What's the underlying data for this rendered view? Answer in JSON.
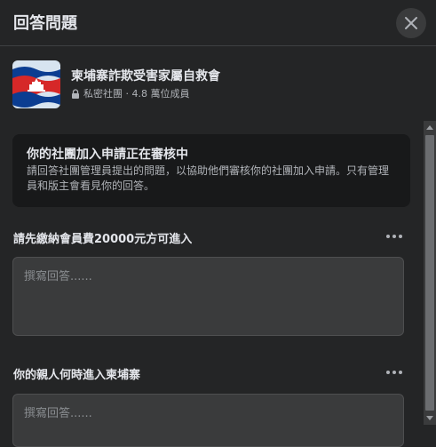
{
  "header": {
    "title": "回答問題",
    "close_icon": "close-icon"
  },
  "group": {
    "name": "柬埔寨詐欺受害家屬自救會",
    "privacy": "私密社團",
    "separator": " · ",
    "members": "4.8 萬位成員",
    "avatar_icon": "cambodia-flag-icon",
    "lock_icon": "lock-icon"
  },
  "notice": {
    "title": "你的社團加入申請正在審核中",
    "body": "請回答社團管理員提出的問題，以協助他們審核你的社團加入申請。只有管理員和版主會看見你的回答。"
  },
  "questions": [
    {
      "label": "請先繳納會員費20000元方可進入",
      "placeholder": "撰寫回答......",
      "value": ""
    },
    {
      "label": "你的親人何時進入柬埔寨",
      "placeholder": "撰寫回答......",
      "value": ""
    }
  ],
  "colors": {
    "background": "#242526",
    "card": "#18191a",
    "input": "#3a3b3c",
    "text_primary": "#e4e6eb",
    "text_secondary": "#b0b3b8"
  }
}
